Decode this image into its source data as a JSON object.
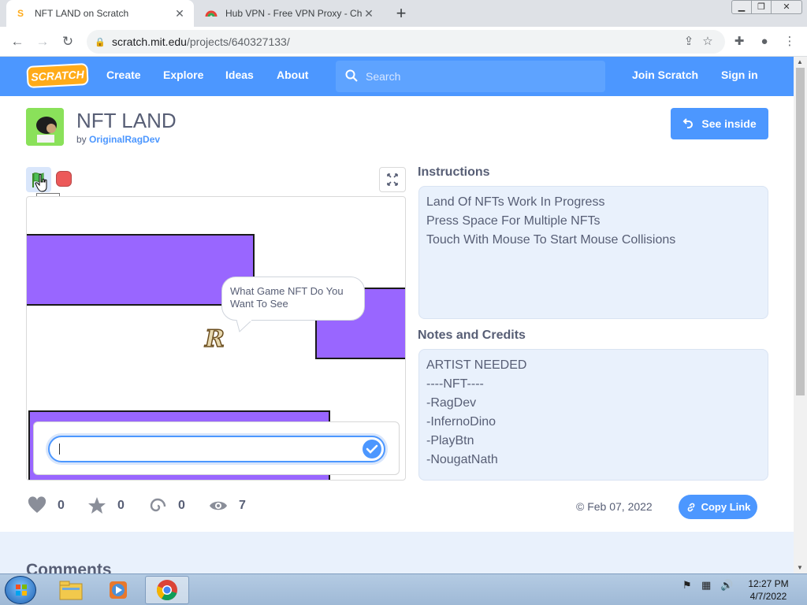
{
  "browser": {
    "tabs": [
      {
        "title": "NFT LAND on Scratch",
        "active": true
      },
      {
        "title": "Hub VPN - Free VPN Proxy - Chr",
        "active": false
      }
    ],
    "url_host": "scratch.mit.edu",
    "url_path": "/projects/640327133/"
  },
  "nav": {
    "logo": "SCRATCH",
    "links": [
      "Create",
      "Explore",
      "Ideas",
      "About"
    ],
    "search_placeholder": "Search",
    "join": "Join Scratch",
    "signin": "Sign in"
  },
  "project": {
    "title": "NFT LAND",
    "by": "by",
    "author": "OriginalRagDev",
    "see_inside": "See inside"
  },
  "player": {
    "tooltip": "Go",
    "speech": "What Game NFT Do You Want To See"
  },
  "instructions": {
    "heading": "Instructions",
    "lines": [
      "Land Of NFTs Work In Progress",
      "Press Space For Multiple NFTs",
      "Touch With Mouse To Start Mouse Collisions"
    ]
  },
  "notes": {
    "heading": "Notes and Credits",
    "lines": [
      "ARTIST NEEDED",
      "----NFT----",
      "-RagDev",
      "-InfernoDino",
      "-PlayBtn",
      "-NougatNath"
    ]
  },
  "stats": {
    "loves": "0",
    "favorites": "0",
    "remixes": "0",
    "views": "7",
    "date": "© Feb 07, 2022",
    "copy_link": "Copy Link"
  },
  "comments_heading": "Comments",
  "taskbar": {
    "time": "12:27 PM",
    "date": "4/7/2022"
  },
  "colors": {
    "scratch_blue": "#4c97ff",
    "sprite_purple": "#9966ff",
    "stop_red": "#ec5959"
  }
}
